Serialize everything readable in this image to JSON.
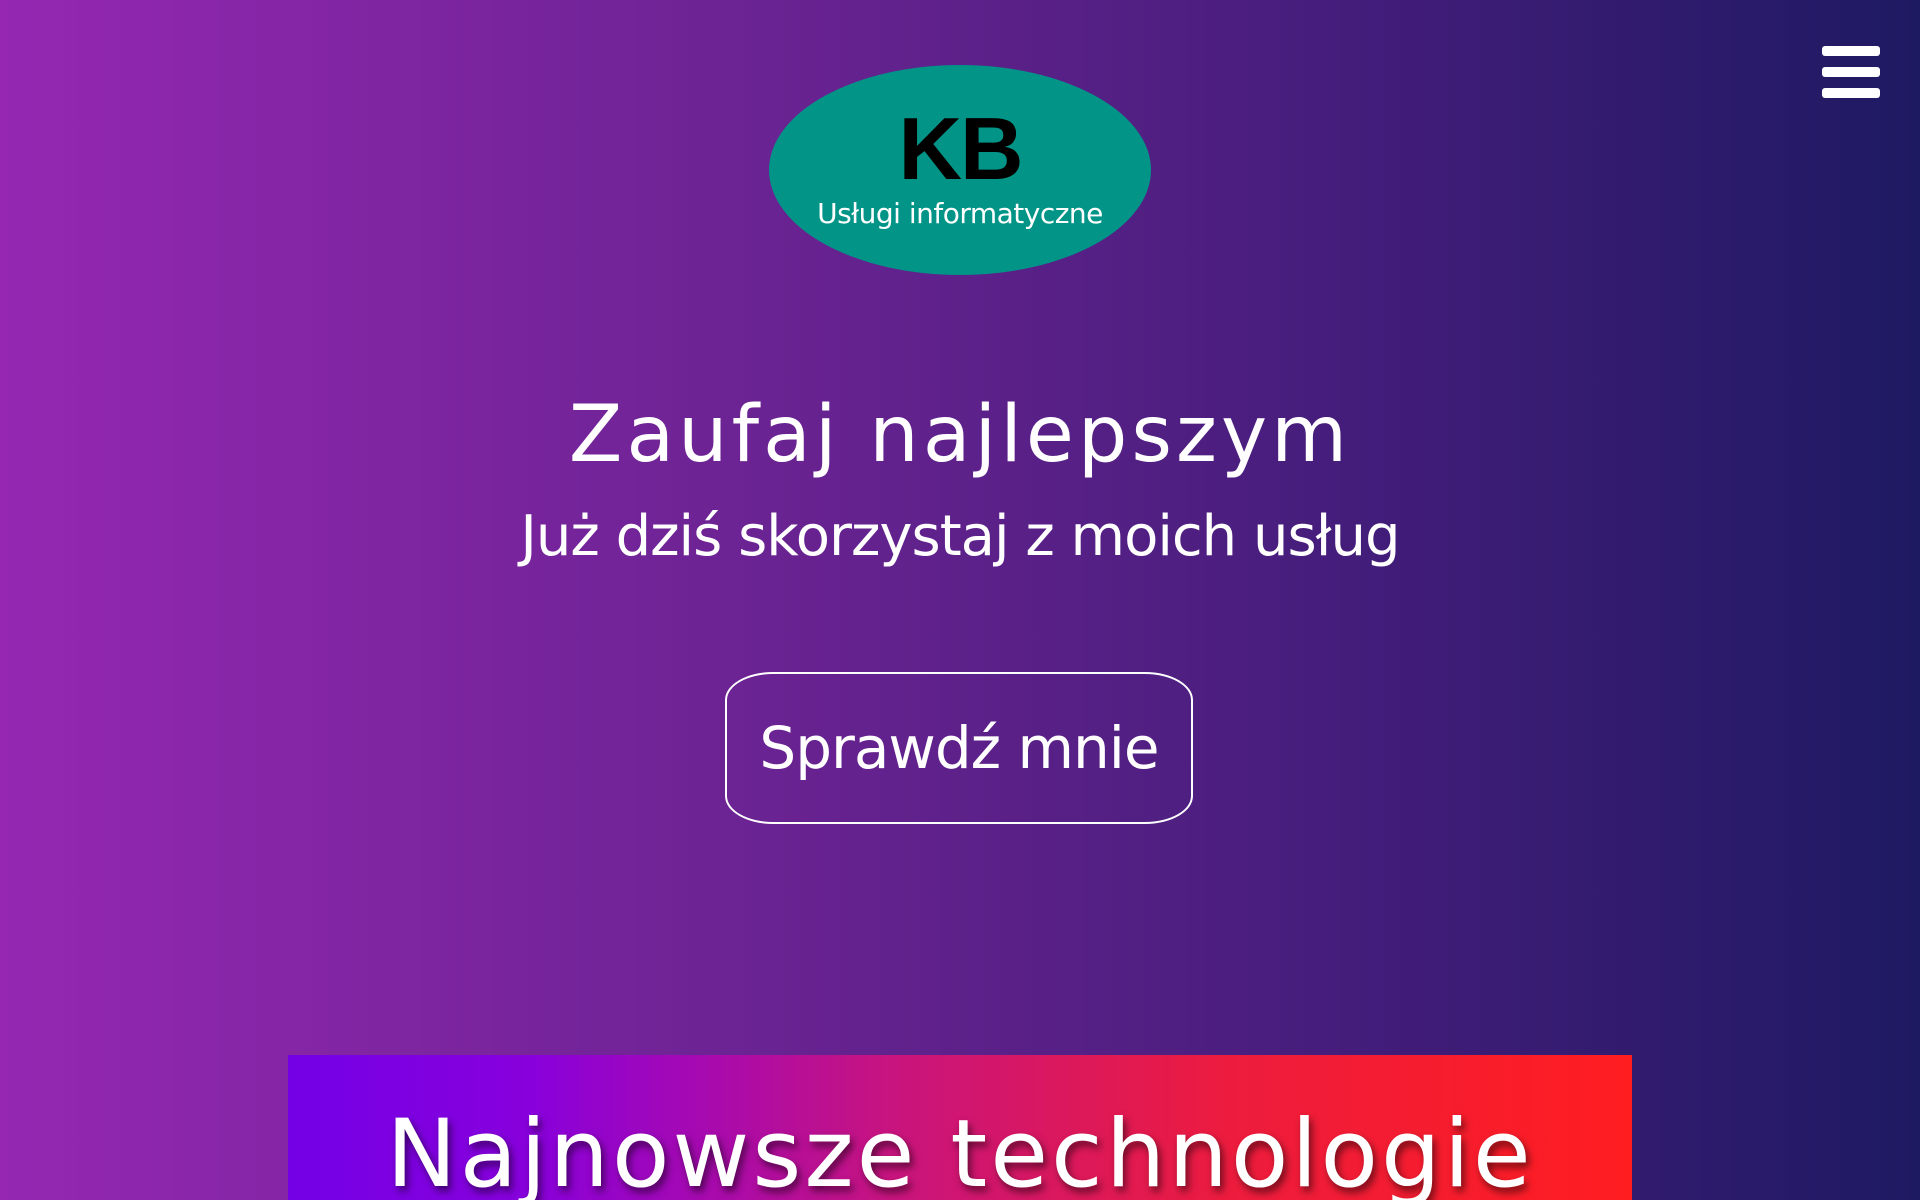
{
  "header": {
    "menu_icon": "hamburger-menu-icon"
  },
  "logo": {
    "mark": "KB",
    "tagline": "Usługi informatyczne"
  },
  "hero": {
    "title": "Zaufaj najlepszym",
    "subtitle": "Już dziś skorzystaj z moich usług",
    "cta_label": "Sprawdź mnie"
  },
  "tech_section": {
    "title": "Najnowsze technologie"
  },
  "colors": {
    "background_left": "#9527b2",
    "background_right": "#1e1a62",
    "logo_background": "#029587",
    "banner_left": "#7400e6",
    "banner_right": "#ff1d20"
  }
}
